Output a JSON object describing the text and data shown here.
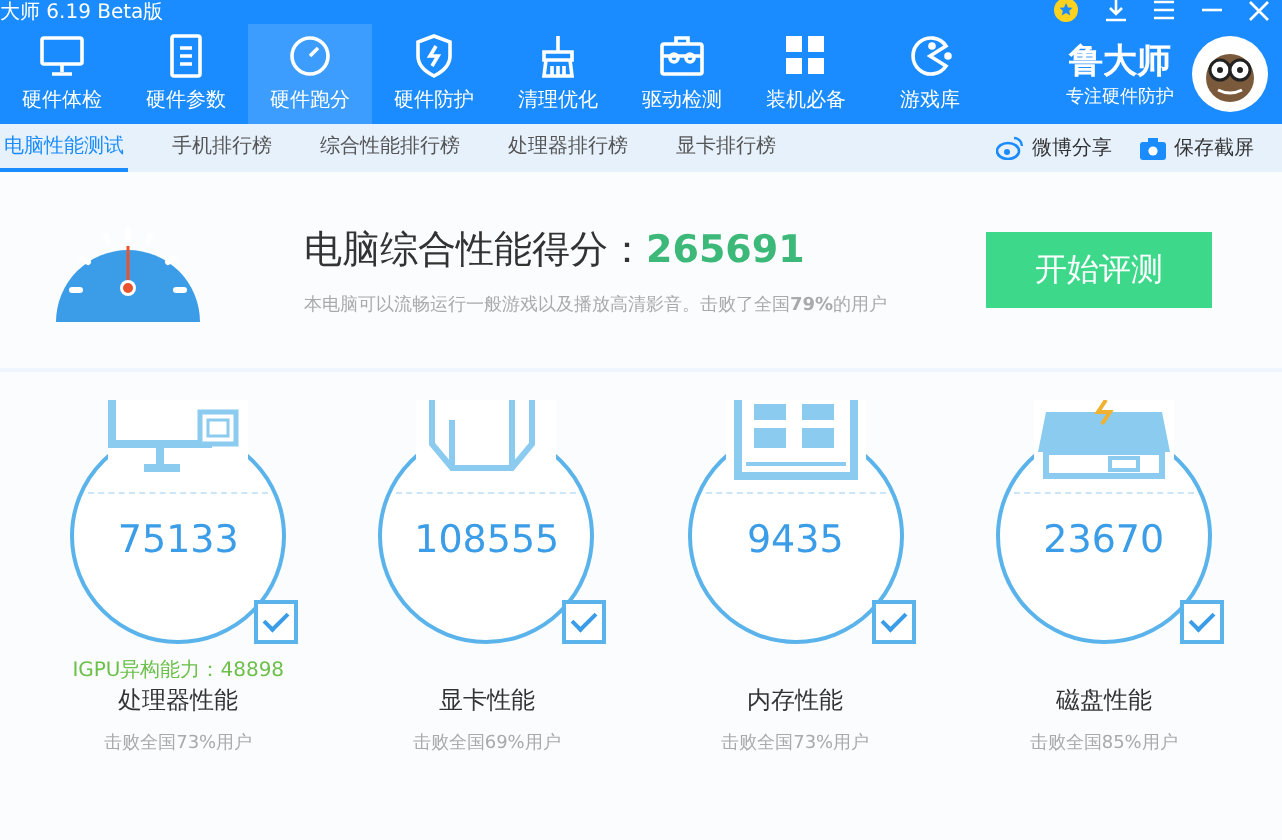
{
  "window": {
    "title": "大师 6.19 Beta版"
  },
  "nav": [
    {
      "label": "硬件体检",
      "selected": false
    },
    {
      "label": "硬件参数",
      "selected": false
    },
    {
      "label": "硬件跑分",
      "selected": true
    },
    {
      "label": "硬件防护",
      "selected": false
    },
    {
      "label": "清理优化",
      "selected": false
    },
    {
      "label": "驱动检测",
      "selected": false
    },
    {
      "label": "装机必备",
      "selected": false
    },
    {
      "label": "游戏库",
      "selected": false
    }
  ],
  "brand": {
    "name": "鲁大师",
    "slogan": "专注硬件防护"
  },
  "subtabs": [
    {
      "label": "电脑性能测试",
      "selected": true
    },
    {
      "label": "手机排行榜",
      "selected": false
    },
    {
      "label": "综合性能排行榜",
      "selected": false
    },
    {
      "label": "处理器排行榜",
      "selected": false
    },
    {
      "label": "显卡排行榜",
      "selected": false
    }
  ],
  "actions": [
    {
      "label": "微博分享"
    },
    {
      "label": "保存截屏"
    }
  ],
  "score": {
    "label": "电脑综合性能得分：",
    "value": "265691",
    "description": "本电脑可以流畅运行一般游戏以及播放高清影音。击败了全国**79%**的用户",
    "button": "开始评测"
  },
  "cards": [
    {
      "value": "75133",
      "checked": true,
      "extra": "IGPU异构能力：48898",
      "title": "处理器性能",
      "rank": "击败全国73%用户"
    },
    {
      "value": "108555",
      "checked": true,
      "title": "显卡性能",
      "rank": "击败全国69%用户"
    },
    {
      "value": "9435",
      "checked": true,
      "title": "内存性能",
      "rank": "击败全国73%用户"
    },
    {
      "value": "23670",
      "checked": true,
      "title": "磁盘性能",
      "rank": "击败全国85%用户"
    }
  ]
}
